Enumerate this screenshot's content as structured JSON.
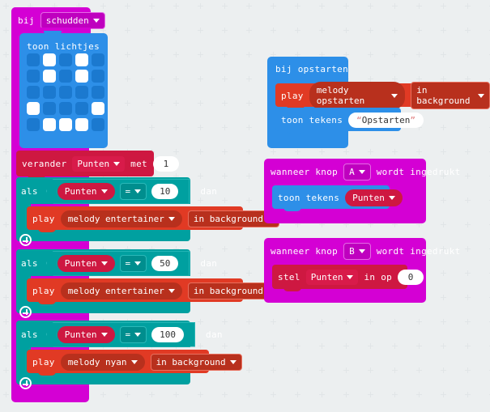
{
  "app": {
    "name": "makecode-microbit-block-editor",
    "language": "nl",
    "canvas_background": "#eceff0"
  },
  "colors": {
    "event": "#d400d4",
    "basic": "#2d8fe8",
    "variables": "#ce1841",
    "logic": "#00a0a0",
    "music": "#e13a24",
    "led_on": "#ffffff",
    "led_off": "#1b79cf"
  },
  "scripts": [
    {
      "id": "on-shake",
      "hat": {
        "keyword": "bij",
        "event": "schudden"
      },
      "children": [
        {
          "type": "show-leds",
          "label": "toon lichtjes",
          "leds": [
            [
              0,
              1,
              0,
              1,
              0
            ],
            [
              0,
              1,
              0,
              1,
              0
            ],
            [
              0,
              0,
              0,
              0,
              0
            ],
            [
              1,
              0,
              0,
              0,
              1
            ],
            [
              0,
              1,
              1,
              1,
              0
            ]
          ]
        },
        {
          "type": "change-variable",
          "keyword": "verander",
          "variable": "Punten",
          "by_label": "met",
          "value": "1"
        },
        {
          "type": "if",
          "keyword": "als",
          "then_label": "dan",
          "condition": {
            "left": "Punten",
            "operator": "=",
            "right": "10"
          },
          "body": [
            {
              "type": "play-melody",
              "keyword": "play",
              "melody": "melody entertainer",
              "mode": "in background"
            }
          ]
        },
        {
          "type": "if",
          "keyword": "als",
          "then_label": "dan",
          "condition": {
            "left": "Punten",
            "operator": "=",
            "right": "50"
          },
          "body": [
            {
              "type": "play-melody",
              "keyword": "play",
              "melody": "melody entertainer",
              "mode": "in background"
            }
          ]
        },
        {
          "type": "if",
          "keyword": "als",
          "then_label": "dan",
          "condition": {
            "left": "Punten",
            "operator": "=",
            "right": "100"
          },
          "body": [
            {
              "type": "play-melody",
              "keyword": "play",
              "melody": "melody nyan",
              "mode": "in background"
            }
          ]
        }
      ]
    },
    {
      "id": "on-start",
      "hat": {
        "label": "bij opstarten"
      },
      "children": [
        {
          "type": "play-melody",
          "keyword": "play",
          "melody": "melody opstarten",
          "mode": "in background"
        },
        {
          "type": "show-string",
          "keyword": "toon tekens",
          "value": "Opstarten"
        }
      ]
    },
    {
      "id": "on-button-a",
      "hat": {
        "prefix": "wanneer knop",
        "button": "A",
        "suffix": "wordt ingedrukt"
      },
      "children": [
        {
          "type": "show-number",
          "keyword": "toon tekens",
          "variable": "Punten"
        }
      ]
    },
    {
      "id": "on-button-b",
      "hat": {
        "prefix": "wanneer knop",
        "button": "B",
        "suffix": "wordt ingedrukt"
      },
      "children": [
        {
          "type": "set-variable",
          "keyword": "stel",
          "variable": "Punten",
          "to_label": "in op",
          "value": "0"
        }
      ]
    }
  ]
}
